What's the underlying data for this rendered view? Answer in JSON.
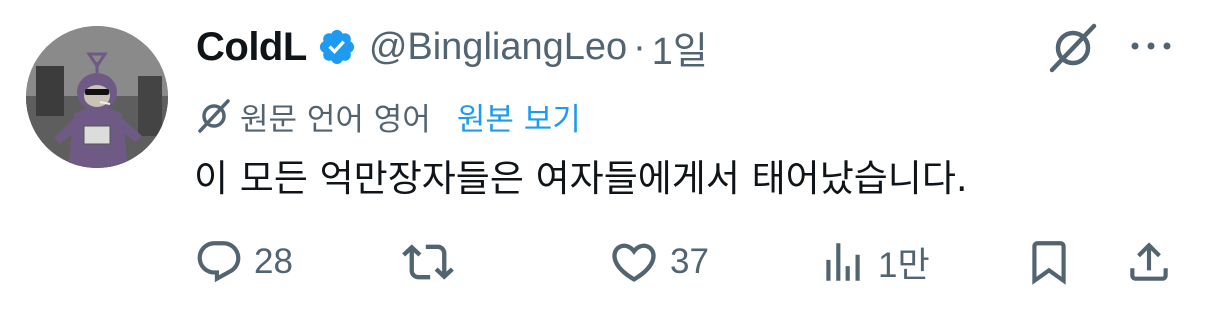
{
  "tweet": {
    "author": {
      "display_name": "ColdL",
      "handle": "@BingliangLeo",
      "verified": true
    },
    "separator": "·",
    "time": "1일",
    "translation": {
      "note": "원문 언어 영어",
      "show_original": "원본 보기"
    },
    "text": "이 모든 억만장자들은 여자들에게서 태어났습니다.",
    "actions": {
      "replies": "28",
      "likes": "37",
      "views": "1만"
    }
  },
  "colors": {
    "accent": "#1d9bf0",
    "secondary_text": "#536471",
    "primary_text": "#0f1419"
  },
  "icons": {
    "top_right": [
      "grok-icon",
      "more-icon"
    ],
    "actions": [
      "reply-icon",
      "retweet-icon",
      "like-icon",
      "views-icon",
      "bookmark-icon",
      "share-icon"
    ]
  }
}
